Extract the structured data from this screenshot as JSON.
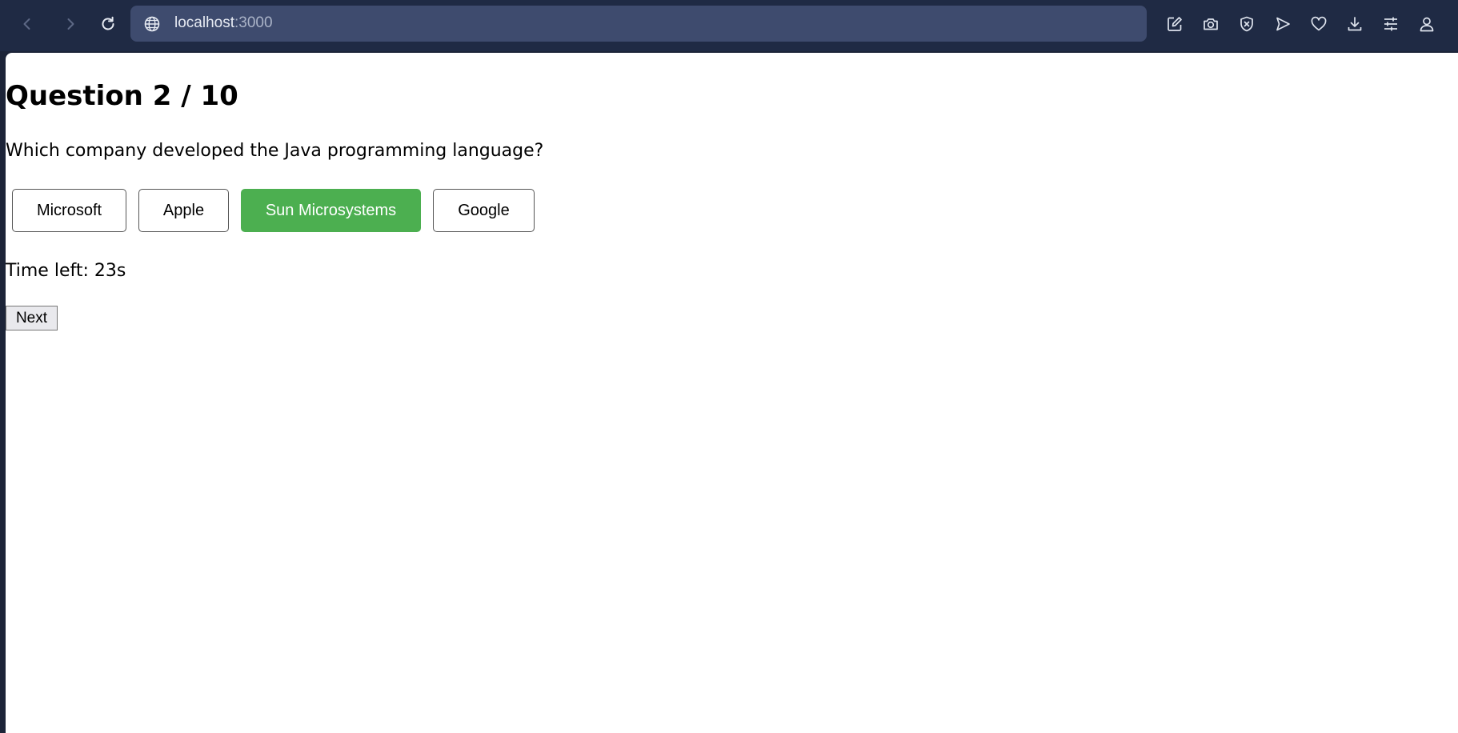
{
  "browser": {
    "url_host": "localhost",
    "url_port": ":3000",
    "icons": {
      "back": "chevron-left-icon",
      "forward": "chevron-right-icon",
      "reload": "reload-icon",
      "site_info": "globe-icon",
      "toolbar": [
        "edit-icon",
        "camera-icon",
        "shield-x-icon",
        "send-icon",
        "heart-icon",
        "download-icon",
        "sliders-icon",
        "profile-icon"
      ]
    }
  },
  "quiz": {
    "heading": "Question 2 / 10",
    "question": "Which company developed the Java programming language?",
    "options": [
      {
        "label": "Microsoft",
        "selected": false
      },
      {
        "label": "Apple",
        "selected": false
      },
      {
        "label": "Sun Microsystems",
        "selected": true
      },
      {
        "label": "Google",
        "selected": false
      }
    ],
    "timer_text": "Time left: 23s",
    "next_label": "Next"
  },
  "colors": {
    "chrome_bg": "#1f2a44",
    "address_bar_bg": "#3e4b6e",
    "selected_option": "#4caf50"
  }
}
